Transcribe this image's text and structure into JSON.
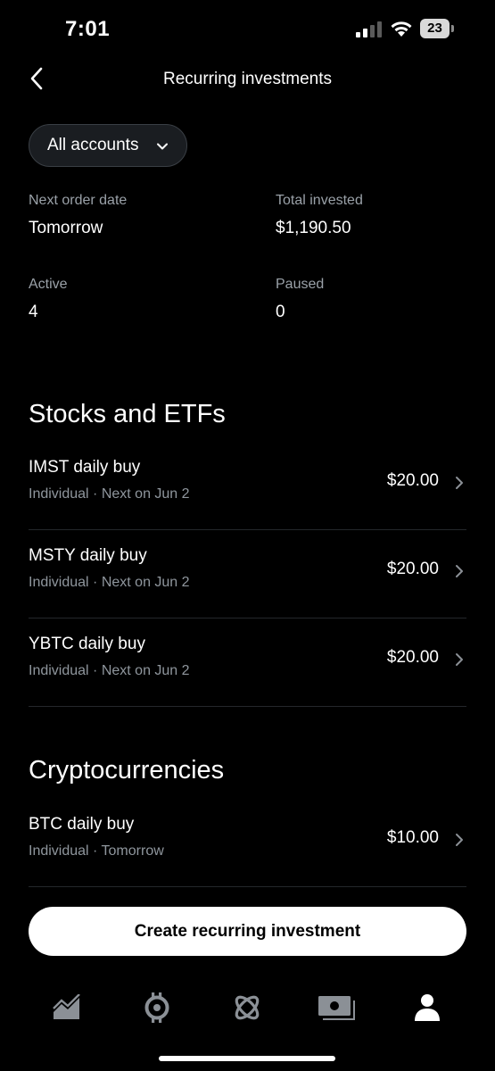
{
  "status_bar": {
    "time": "7:01",
    "battery": "23"
  },
  "header": {
    "title": "Recurring investments"
  },
  "account_selector": {
    "label": "All accounts"
  },
  "summary": {
    "next_order_date_label": "Next order date",
    "next_order_date_value": "Tomorrow",
    "total_invested_label": "Total invested",
    "total_invested_value": "$1,190.50",
    "active_label": "Active",
    "active_value": "4",
    "paused_label": "Paused",
    "paused_value": "0"
  },
  "sections": [
    {
      "heading": "Stocks and ETFs",
      "items": [
        {
          "title": "IMST daily buy",
          "subtitle": "Individual · Next on Jun 2",
          "amount": "$20.00"
        },
        {
          "title": "MSTY daily buy",
          "subtitle": "Individual · Next on Jun 2",
          "amount": "$20.00"
        },
        {
          "title": "YBTC daily buy",
          "subtitle": "Individual · Next on Jun 2",
          "amount": "$20.00"
        }
      ]
    },
    {
      "heading": "Cryptocurrencies",
      "items": [
        {
          "title": "BTC daily buy",
          "subtitle": "Individual · Tomorrow",
          "amount": "$10.00"
        }
      ]
    }
  ],
  "cta": {
    "label": "Create recurring investment"
  },
  "tab_bar": {
    "tabs": [
      {
        "icon": "chart-icon"
      },
      {
        "icon": "bitcoin-coin-icon"
      },
      {
        "icon": "orbit-icon"
      },
      {
        "icon": "cash-icon"
      },
      {
        "icon": "profile-icon"
      }
    ],
    "active_index": 4
  },
  "colors": {
    "background": "#000000",
    "text_primary": "#ffffff",
    "text_secondary": "#9aa1a8",
    "divider": "#24272b",
    "tab_inactive": "#8b9096"
  }
}
